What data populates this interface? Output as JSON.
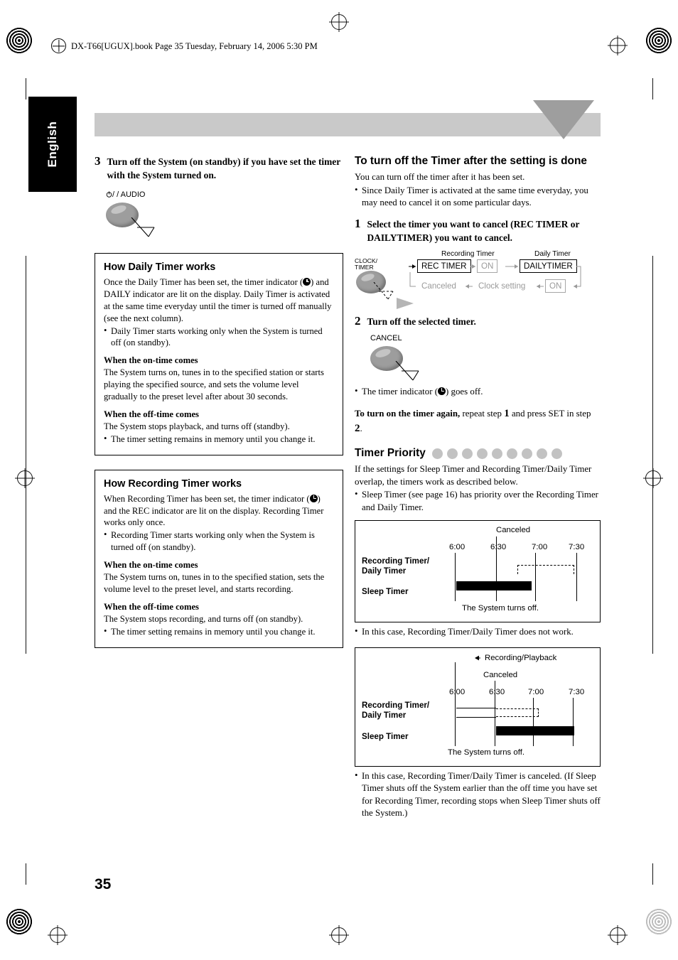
{
  "header": {
    "filename_line": "DX-T66[UGUX].book  Page 35  Tuesday, February 14, 2006  5:30 PM"
  },
  "language_tab": "English",
  "page_number": "35",
  "left_column": {
    "step3": {
      "number": "3",
      "text": "Turn off the System (on standby) if you have set the timer with the System turned on."
    },
    "button_audio_label": "/ AUDIO",
    "box1": {
      "title": "How Daily Timer works",
      "para1_a": "Once the Daily Timer has been set, the timer indicator (",
      "para1_b": ") and DAILY indicator are lit on the display. Daily Timer is activated at the same time everyday until the timer is turned off manually (see the next column).",
      "bullets1": [
        "Daily Timer starts working only when the System is turned off (on standby)."
      ],
      "sub1": "When the on-time comes",
      "para2": "The System turns on, tunes in to the specified station or starts playing the specified source, and sets the volume level gradually to the preset level after about 30 seconds.",
      "sub2": "When the off-time comes",
      "para3": "The System stops playback, and turns off (standby).",
      "bullets2": [
        "The timer setting remains in memory until you change it."
      ]
    },
    "box2": {
      "title": "How Recording Timer works",
      "para1_a": "When Recording Timer has been set, the timer indicator (",
      "para1_b": ") and the REC indicator are lit on the display. Recording Timer works only once.",
      "bullets1": [
        "Recording Timer starts working only when the System is turned off (on standby)."
      ],
      "sub1": "When the on-time comes",
      "para2": "The System turns on, tunes in to the specified station, sets the volume level to the preset level, and starts recording.",
      "sub2": "When the off-time comes",
      "para3": "The System stops recording, and turns off (on standby).",
      "bullets2": [
        "The timer setting remains in memory until you change it."
      ]
    }
  },
  "right_column": {
    "heading": "To turn off the Timer after the setting is done",
    "intro": "You can turn off the timer after it has been set.",
    "intro_bullets": [
      "Since Daily Timer is activated at the same time everyday, you may need to cancel it on some particular days."
    ],
    "step1": {
      "number": "1",
      "text": "Select the timer you want to cancel (REC TIMER or DAILYTIMER) you want to cancel."
    },
    "flow": {
      "button_label_line1": "CLOCK/",
      "button_label_line2": "TIMER",
      "label_recording_timer": "Recording Timer",
      "label_daily_timer": "Daily Timer",
      "box_rec_timer": "REC TIMER",
      "box_on_top": "ON",
      "box_dailytimer": "DAILYTIMER",
      "box_canceled": "Canceled",
      "box_clock_setting": "Clock setting",
      "box_on_bottom": "ON"
    },
    "step2": {
      "number": "2",
      "text": "Turn off the selected timer."
    },
    "cancel_button_label": "CANCEL",
    "after_cancel_bullet_a": "The timer indicator (",
    "after_cancel_bullet_b": ") goes off.",
    "turn_on_again_a": "To turn on the timer again,",
    "turn_on_again_b": "repeat step",
    "turn_on_again_num1": "1",
    "turn_on_again_c": "and press SET in step",
    "turn_on_again_num2": "2",
    "turn_on_again_d": ".",
    "timer_priority": {
      "title": "Timer Priority",
      "para": "If the settings for Sleep Timer and Recording Timer/Daily Timer overlap, the timers work as described below.",
      "bullets": [
        "Sleep Timer (see page 16) has priority over the Recording Timer and Daily Timer."
      ]
    },
    "chart1": {
      "top_label": "Canceled",
      "times": [
        "6:00",
        "6:30",
        "7:00",
        "7:30"
      ],
      "row1_line1": "Recording Timer/",
      "row1_line2": "Daily Timer",
      "row2": "Sleep Timer",
      "bottom_note": "The System turns off.",
      "caption": "In this case, Recording Timer/Daily Timer does not work."
    },
    "chart2": {
      "top_label": "Recording/Playback",
      "second_label": "Canceled",
      "times": [
        "6:00",
        "6:30",
        "7:00",
        "7:30"
      ],
      "row1_line1": "Recording Timer/",
      "row1_line2": "Daily Timer",
      "row2": "Sleep Timer",
      "bottom_note": "The System turns off.",
      "caption": "In this case, Recording Timer/Daily Timer is canceled. (If Sleep Timer shuts off the System earlier than the off time you have set for Recording Timer, recording stops when Sleep Timer shuts off the System.)"
    }
  }
}
